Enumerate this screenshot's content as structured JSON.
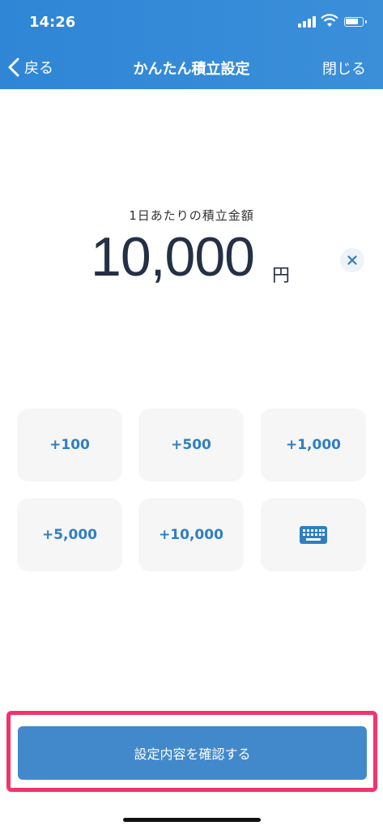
{
  "status_bar": {
    "time": "14:26"
  },
  "nav": {
    "back_label": "戻る",
    "title": "かんたん積立設定",
    "close_label": "閉じる"
  },
  "amount": {
    "label": "1日あたりの積立金額",
    "value": "10,000",
    "unit": "円"
  },
  "increment_buttons": [
    "+100",
    "+500",
    "+1,000",
    "+5,000",
    "+10,000"
  ],
  "keyboard_button": {
    "icon": "keyboard-icon"
  },
  "confirm_button": {
    "label": "設定内容を確認する"
  },
  "colors": {
    "header": "#3a8fd9",
    "accent": "#2f7fc1",
    "button": "#4289cc",
    "highlight": "#f2336d"
  }
}
